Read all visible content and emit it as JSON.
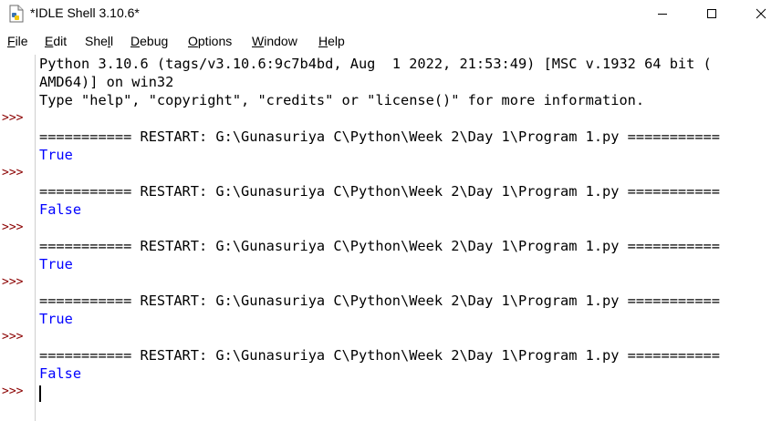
{
  "window": {
    "title": "*IDLE Shell 3.10.6*"
  },
  "menu": {
    "items": [
      {
        "label": "File",
        "ul": "F",
        "rest": "ile"
      },
      {
        "label": "Edit",
        "ul": "E",
        "rest": "dit"
      },
      {
        "label": "Shell",
        "pre": "She",
        "ul": "l",
        "rest": "l"
      },
      {
        "label": "Debug",
        "ul": "D",
        "rest": "ebug"
      },
      {
        "label": "Options",
        "ul": "O",
        "rest": "ptions"
      },
      {
        "label": "Window",
        "ul": "W",
        "rest": "indow"
      },
      {
        "label": "Help",
        "ul": "H",
        "rest": "elp"
      }
    ]
  },
  "shell": {
    "prompt": ">>>",
    "banner_line1": "Python 3.10.6 (tags/v3.10.6:9c7b4bd, Aug  1 2022, 21:53:49) [MSC v.1932 64 bit (",
    "banner_line2": "AMD64)] on win32",
    "banner_line3": "Type \"help\", \"copyright\", \"credits\" or \"license()\" for more information.",
    "restart_line": "=========== RESTART: G:\\Gunasuriya C\\Python\\Week 2\\Day 1\\Program 1.py ===========",
    "outputs": [
      "True",
      "False",
      "True",
      "True",
      "False"
    ]
  },
  "icons": {
    "app": "idle-document-icon",
    "minimize": "minimize-icon",
    "maximize": "maximize-icon",
    "close": "close-icon"
  },
  "colors": {
    "prompt": "#8b0000",
    "output": "#0000ff",
    "text": "#000000"
  }
}
